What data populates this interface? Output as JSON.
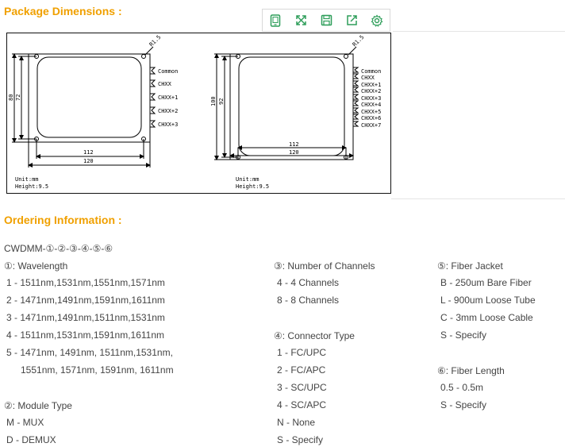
{
  "package_title": "Package Dimensions :",
  "toolbar": {
    "icons": [
      "tablet-icon",
      "expand-icon",
      "save-icon",
      "share-icon",
      "settings-icon"
    ]
  },
  "drawing": {
    "left": {
      "radius": "R1.5",
      "ports": [
        "Common",
        "CHXX",
        "CHXX+1",
        "CHXX+2",
        "CHXX+3"
      ],
      "outer_width": "120",
      "inner_width": "112",
      "outer_height": "80",
      "inner_height": "72",
      "unit": "Unit:mm",
      "height": "Height:9.5"
    },
    "right": {
      "radius": "R1.5",
      "ports": [
        "Common",
        "CHXX",
        "CHXX+1",
        "CHXX+2",
        "CHXX+3",
        "CHXX+4",
        "CHXX+5",
        "CHXX+6",
        "CHXX+7"
      ],
      "outer_width": "120",
      "inner_width": "112",
      "outer_height": "100",
      "inner_height": "92",
      "unit": "Unit:mm",
      "height": "Height:9.5"
    }
  },
  "ordering_title": "Ordering Information :",
  "part_code": "CWDMM-①-②-③-④-⑤-⑥",
  "wavelength": {
    "title": "①: Wavelength",
    "items": [
      "1 - 1511nm,1531nm,1551nm,1571nm",
      "2 - 1471nm,1491nm,1591nm,1611nm",
      "3 - 1471nm,1491nm,1511nm,1531nm",
      "4 - 1511nm,1531nm,1591nm,1611nm",
      "5 - 1471nm, 1491nm, 1511nm,1531nm,",
      "1551nm, 1571nm, 1591nm, 1611nm"
    ]
  },
  "module_type": {
    "title": "②: Module Type",
    "items": [
      "M - MUX",
      "D - DEMUX"
    ]
  },
  "channels": {
    "title": "③: Number of Channels",
    "items": [
      "4 - 4 Channels",
      "8 - 8 Channels"
    ]
  },
  "connector": {
    "title": "④: Connector Type",
    "items": [
      "1 - FC/UPC",
      "2 - FC/APC",
      "3 - SC/UPC",
      "4 - SC/APC",
      "N - None",
      "S - Specify"
    ]
  },
  "jacket": {
    "title": "⑤: Fiber Jacket",
    "items": [
      "B - 250um Bare Fiber",
      "L - 900um Loose Tube",
      "C - 3mm Loose Cable",
      "S - Specify"
    ]
  },
  "length": {
    "title": "⑥: Fiber Length",
    "items": [
      "0.5 - 0.5m",
      "S - Specify"
    ]
  }
}
